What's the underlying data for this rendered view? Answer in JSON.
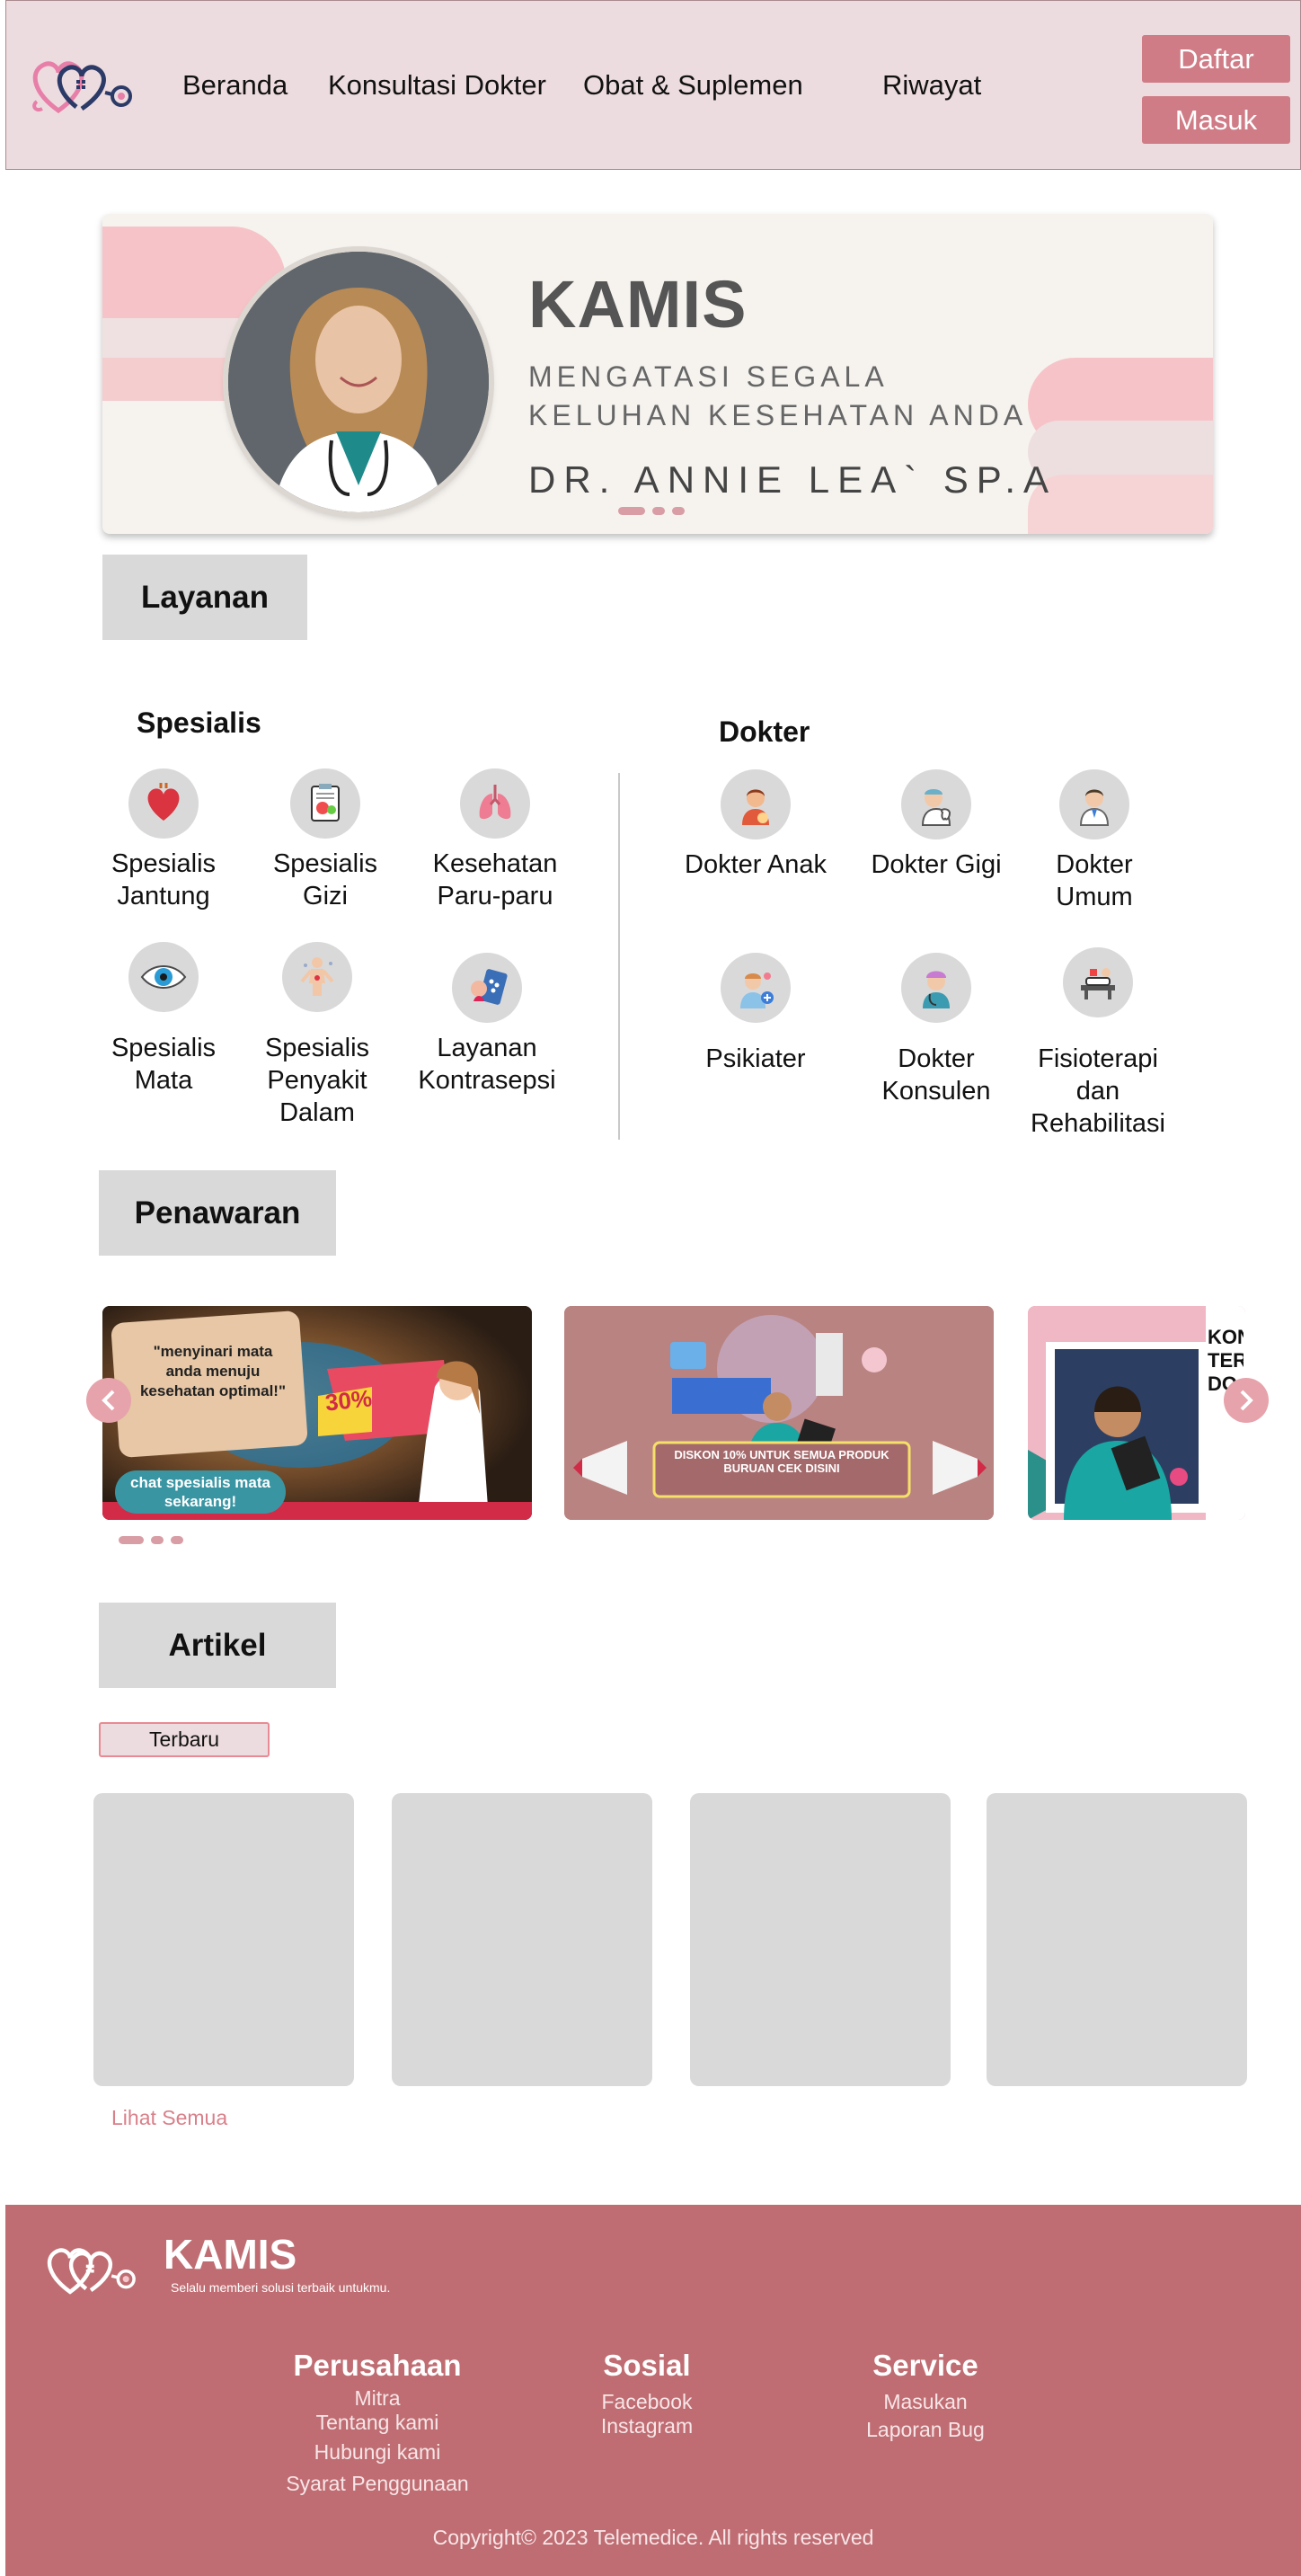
{
  "nav": {
    "items": [
      "Beranda",
      "Konsultasi Dokter",
      "Obat & Suplemen",
      "Riwayat"
    ],
    "daftar": "Daftar",
    "masuk": "Masuk"
  },
  "hero": {
    "title": "KAMIS",
    "subtitle": "MENGATASI SEGALA KELUHAN KESEHATAN ANDA",
    "doctor": "DR. ANNIE LEA` SP.A"
  },
  "layanan": {
    "title": "Layanan",
    "spesialis_title": "Spesialis",
    "dokter_title": "Dokter",
    "spesialis": [
      {
        "label": "Spesialis Jantung",
        "icon": "heart-icon"
      },
      {
        "label": "Spesialis Gizi",
        "icon": "nutrition-icon"
      },
      {
        "label": "Kesehatan Paru-paru",
        "icon": "lungs-icon"
      },
      {
        "label": "Spesialis Mata",
        "icon": "eye-icon"
      },
      {
        "label": "Spesialis Penyakit Dalam",
        "icon": "body-icon"
      },
      {
        "label": "Layanan Kontrasepsi",
        "icon": "contraception-icon"
      }
    ],
    "dokter": [
      {
        "label": "Dokter Anak",
        "icon": "pediatrician-icon"
      },
      {
        "label": "Dokter Gigi",
        "icon": "dentist-icon"
      },
      {
        "label": "Dokter Umum",
        "icon": "general-doctor-icon"
      },
      {
        "label": "Psikiater",
        "icon": "psychiatrist-icon"
      },
      {
        "label": "Dokter Konsulen",
        "icon": "consultant-icon"
      },
      {
        "label": "Fisioterapi dan Rehabilitasi",
        "icon": "physiotherapy-icon"
      }
    ]
  },
  "penawaran": {
    "title": "Penawaran",
    "banner1": {
      "quote": "\"menyinari mata anda menuju kesehatan optimal!\"",
      "discount": "30%",
      "cta": "chat spesialis mata sekarang!"
    },
    "banner2": {
      "text": "DISKON 10% UNTUK SEMUA PRODUK BURUAN CEK DISINI"
    },
    "banner3": {
      "text": "KON TER DO"
    }
  },
  "artikel": {
    "title": "Artikel",
    "filter": "Terbaru",
    "see_all": "Lihat Semua"
  },
  "footer": {
    "brand": "KAMIS",
    "tagline": "Selalu memberi solusi terbaik untukmu.",
    "perusahaan": {
      "title": "Perusahaan",
      "links": [
        "Mitra",
        "Tentang kami",
        "Hubungi kami",
        "Syarat Penggunaan"
      ]
    },
    "sosial": {
      "title": "Sosial",
      "links": [
        "Facebook",
        "Instagram"
      ]
    },
    "service": {
      "title": "Service",
      "links": [
        "Masukan",
        "Laporan Bug"
      ]
    },
    "copyright": "Copyright© 2023 Telemedice. All rights reserved"
  },
  "colors": {
    "brand": "#cf7c86",
    "footer": "#bf6d72",
    "header": "#eddcdf"
  }
}
